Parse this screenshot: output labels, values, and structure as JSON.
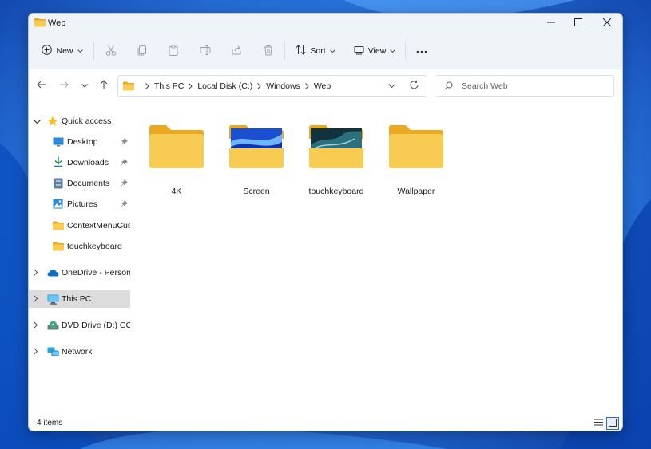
{
  "window": {
    "title": "Web",
    "folder_icon": "folder-icon"
  },
  "toolbar": {
    "new_label": "New",
    "sort_label": "Sort",
    "view_label": "View",
    "icons": [
      "plus-circle-icon",
      "cut-icon",
      "copy-icon",
      "paste-icon",
      "rename-icon",
      "share-icon",
      "delete-icon",
      "sort-icon",
      "view-icon",
      "more-icon"
    ]
  },
  "address": {
    "crumbs": [
      "This PC",
      "Local Disk (C:)",
      "Windows",
      "Web"
    ]
  },
  "search": {
    "placeholder": "Search Web"
  },
  "sidebar": {
    "quick_access": "Quick access",
    "items": [
      {
        "label": "Desktop",
        "icon": "desktop-icon",
        "pinned": true
      },
      {
        "label": "Downloads",
        "icon": "download-icon",
        "pinned": true
      },
      {
        "label": "Documents",
        "icon": "documents-icon",
        "pinned": true
      },
      {
        "label": "Pictures",
        "icon": "pictures-icon",
        "pinned": true
      },
      {
        "label": "ContextMenuCust",
        "icon": "folder-icon",
        "pinned": false
      },
      {
        "label": "touchkeyboard",
        "icon": "folder-icon",
        "pinned": false
      }
    ],
    "onedrive": "OneDrive - Personal",
    "this_pc": "This PC",
    "dvd": "DVD Drive (D:) CCCC",
    "network": "Network"
  },
  "files": [
    {
      "name": "4K",
      "type": "plain"
    },
    {
      "name": "Screen",
      "type": "blue-preview"
    },
    {
      "name": "touchkeyboard",
      "type": "dark-preview"
    },
    {
      "name": "Wallpaper",
      "type": "plain"
    }
  ],
  "status": {
    "count": "4 items"
  },
  "colors": {
    "accent": "#0067c0",
    "folder": "#f8cb52",
    "folder_back": "#eaa823",
    "selection": "#dcdcdc"
  }
}
